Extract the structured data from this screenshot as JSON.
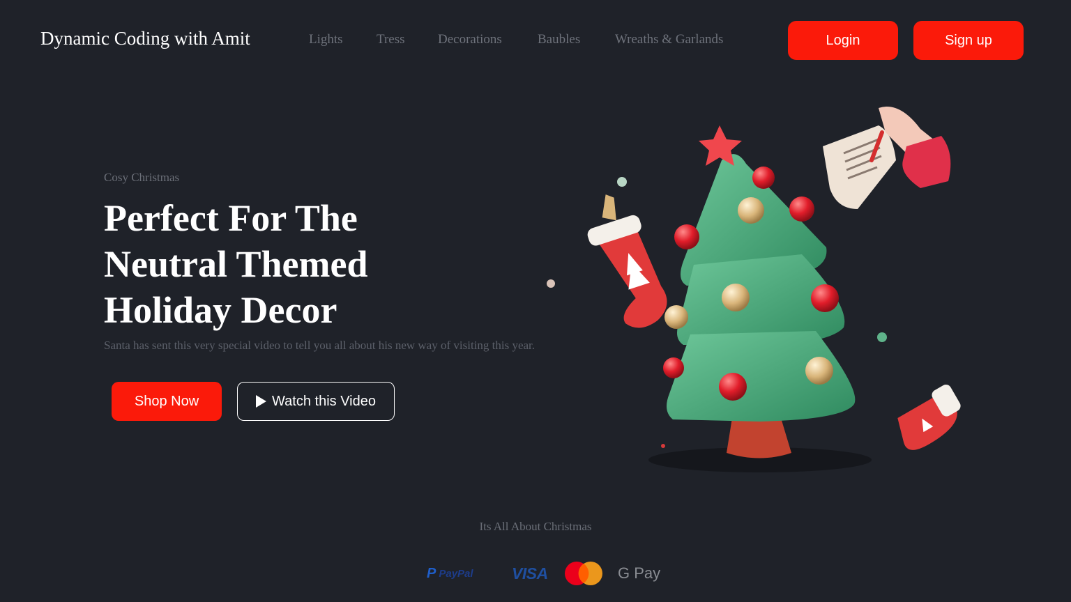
{
  "header": {
    "brand": "Dynamic Coding with Amit",
    "nav": [
      {
        "label": "Lights"
      },
      {
        "label": "Tress"
      },
      {
        "label": "Decorations"
      },
      {
        "label": "Baubles"
      },
      {
        "label": "Wreaths & Garlands"
      }
    ],
    "login_label": "Login",
    "signup_label": "Sign up"
  },
  "hero": {
    "eyebrow": "Cosy Christmas",
    "headline": "Perfect For The Neutral Themed Holiday Decor",
    "subtext": "Santa has sent this very special video to tell you all about his new way of visiting this year.",
    "shop_label": "Shop Now",
    "watch_label": "Watch this Video"
  },
  "footer": {
    "tagline": "Its All About Christmas",
    "payments": {
      "paypal": "PayPal",
      "visa": "VISA",
      "mastercard": "mastercard-logo",
      "gpay": "G Pay"
    }
  },
  "colors": {
    "background": "#1f2229",
    "accent": "#fb1a0a",
    "text_primary": "#ffffff",
    "text_muted": "#6b6f78"
  },
  "icons": {
    "play": "play-icon",
    "illustration": "christmas-tree-illustration"
  }
}
